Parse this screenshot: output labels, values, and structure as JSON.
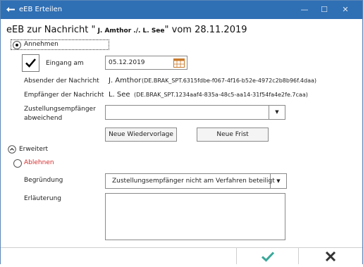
{
  "window": {
    "title": "eEB Erteilen",
    "minimize_icon": "minimize-icon",
    "maximize_icon": "maximize-icon",
    "close_icon": "close-icon"
  },
  "heading": {
    "prefix": "eEB zur Nachricht \"",
    "names": " J. Amthor ./.   L. See",
    "suffix": "\" vom 28.11.2019"
  },
  "accept": {
    "label": "Annehmen",
    "selected": true,
    "eingang_label": "Eingang am",
    "eingang_checked": true,
    "eingang_date": "05.12.2019",
    "sender_label": "Absender der Nachricht",
    "sender_name": "J. Amthor",
    "sender_id": "(DE.BRAK_SPT.6315fdbe-f067-4f16-b52e-4972c2b8b96f.4daa)",
    "recipient_label": "Empfänger der Nachricht",
    "recipient_name": "L. See",
    "recipient_id": "(DE.BRAK_SPT.1234aaf4-835a-48c5-aa14-31f54fa4e2fe.7caa)",
    "deviating_label_1": "Zustellungsempfänger",
    "deviating_label_2": "abweichend",
    "deviating_value": "",
    "btn_wiedervorlage": "Neue Wiedervorlage",
    "btn_frist": "Neue Frist",
    "expander_label": "Erweitert"
  },
  "reject": {
    "label": "Ablehnen",
    "selected": false,
    "reason_label": "Begründung",
    "reason_value": "Zustellungsempfänger nicht am Verfahren beteiligt",
    "explanation_label": "Erläuterung",
    "explanation_value": ""
  },
  "footer": {
    "confirm_icon": "checkmark-icon",
    "cancel_icon": "close-x-icon"
  },
  "colors": {
    "titlebar": "#2f6fb4",
    "reject_label": "#d42d2d",
    "confirm": "#3aa89a",
    "cancel": "#333333"
  }
}
